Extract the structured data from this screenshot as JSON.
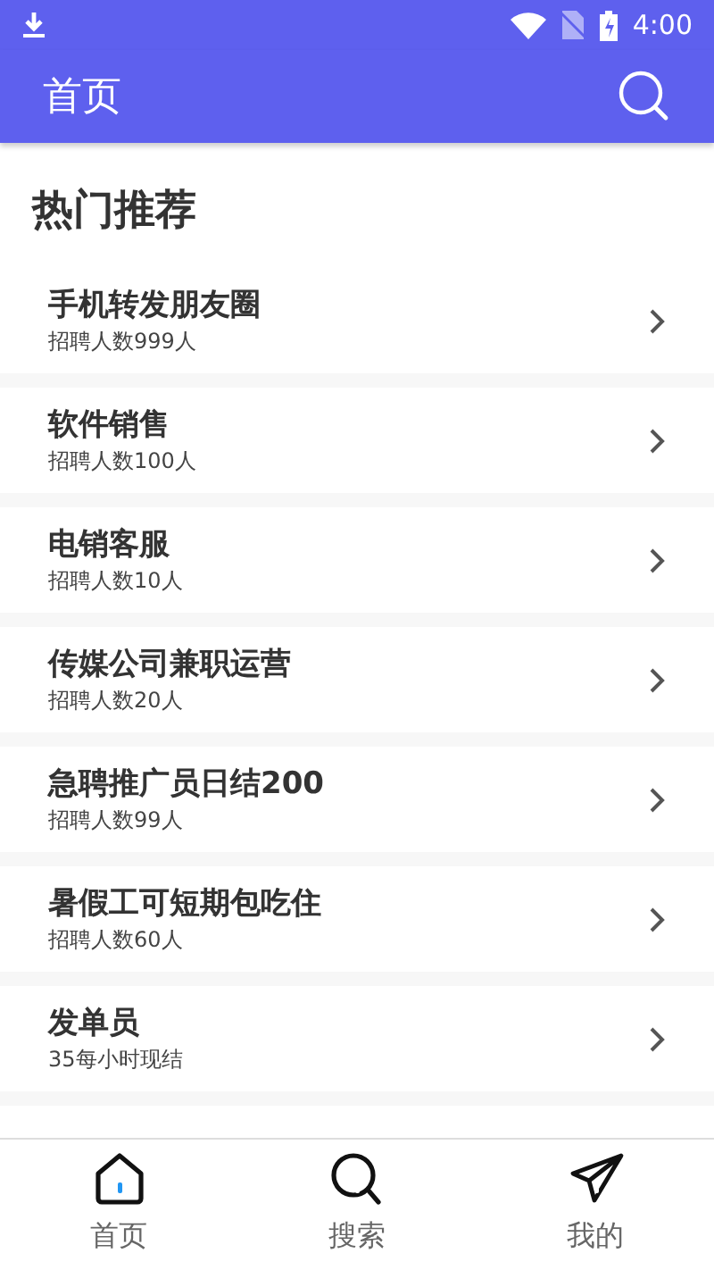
{
  "status_bar": {
    "time": "4:00"
  },
  "app_bar": {
    "title": "首页"
  },
  "section": {
    "title": "热门推荐"
  },
  "jobs": [
    {
      "title": "手机转发朋友圈",
      "subtitle": "招聘人数999人"
    },
    {
      "title": "软件销售",
      "subtitle": "招聘人数100人"
    },
    {
      "title": "电销客服",
      "subtitle": "招聘人数10人"
    },
    {
      "title": "传媒公司兼职运营",
      "subtitle": "招聘人数20人"
    },
    {
      "title": "急聘推广员日结200",
      "subtitle": "招聘人数99人"
    },
    {
      "title": "暑假工可短期包吃住",
      "subtitle": "招聘人数60人"
    },
    {
      "title": "发单员",
      "subtitle": "35每小时现结"
    }
  ],
  "bottom_nav": [
    {
      "label": "首页",
      "kind": "home",
      "selected": true
    },
    {
      "label": "搜索",
      "kind": "search",
      "selected": false
    },
    {
      "label": "我的",
      "kind": "send",
      "selected": false
    }
  ]
}
